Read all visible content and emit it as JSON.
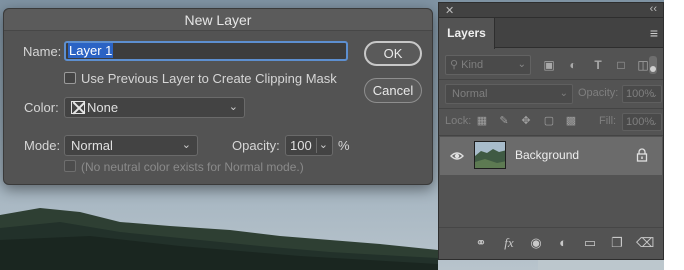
{
  "dialog": {
    "title": "New Layer",
    "name_label": "Name:",
    "name_value": "Layer 1",
    "clip_checkbox_label": "Use Previous Layer to Create Clipping Mask",
    "color_label": "Color:",
    "color_value": "None",
    "mode_label": "Mode:",
    "mode_value": "Normal",
    "opacity_label": "Opacity:",
    "opacity_value": "100",
    "opacity_unit": "%",
    "neutral_label": "(No neutral color exists for Normal mode.)",
    "ok_label": "OK",
    "cancel_label": "Cancel"
  },
  "layers_panel": {
    "tab_label": "Layers",
    "kind_placeholder": "Kind",
    "blend_mode": "Normal",
    "opacity_label": "Opacity:",
    "opacity_value": "100%",
    "lock_label": "Lock:",
    "fill_label": "Fill:",
    "fill_value": "100%",
    "layers": [
      {
        "name": "Background",
        "visible": true,
        "locked": true
      }
    ]
  },
  "colors": {
    "accent_selection": "#2b63c4",
    "focus_ring": "#5d8fd0",
    "dialog_bg": "#535353",
    "panel_bg": "#535353",
    "selected_layer_bg": "#6b6b6b"
  }
}
